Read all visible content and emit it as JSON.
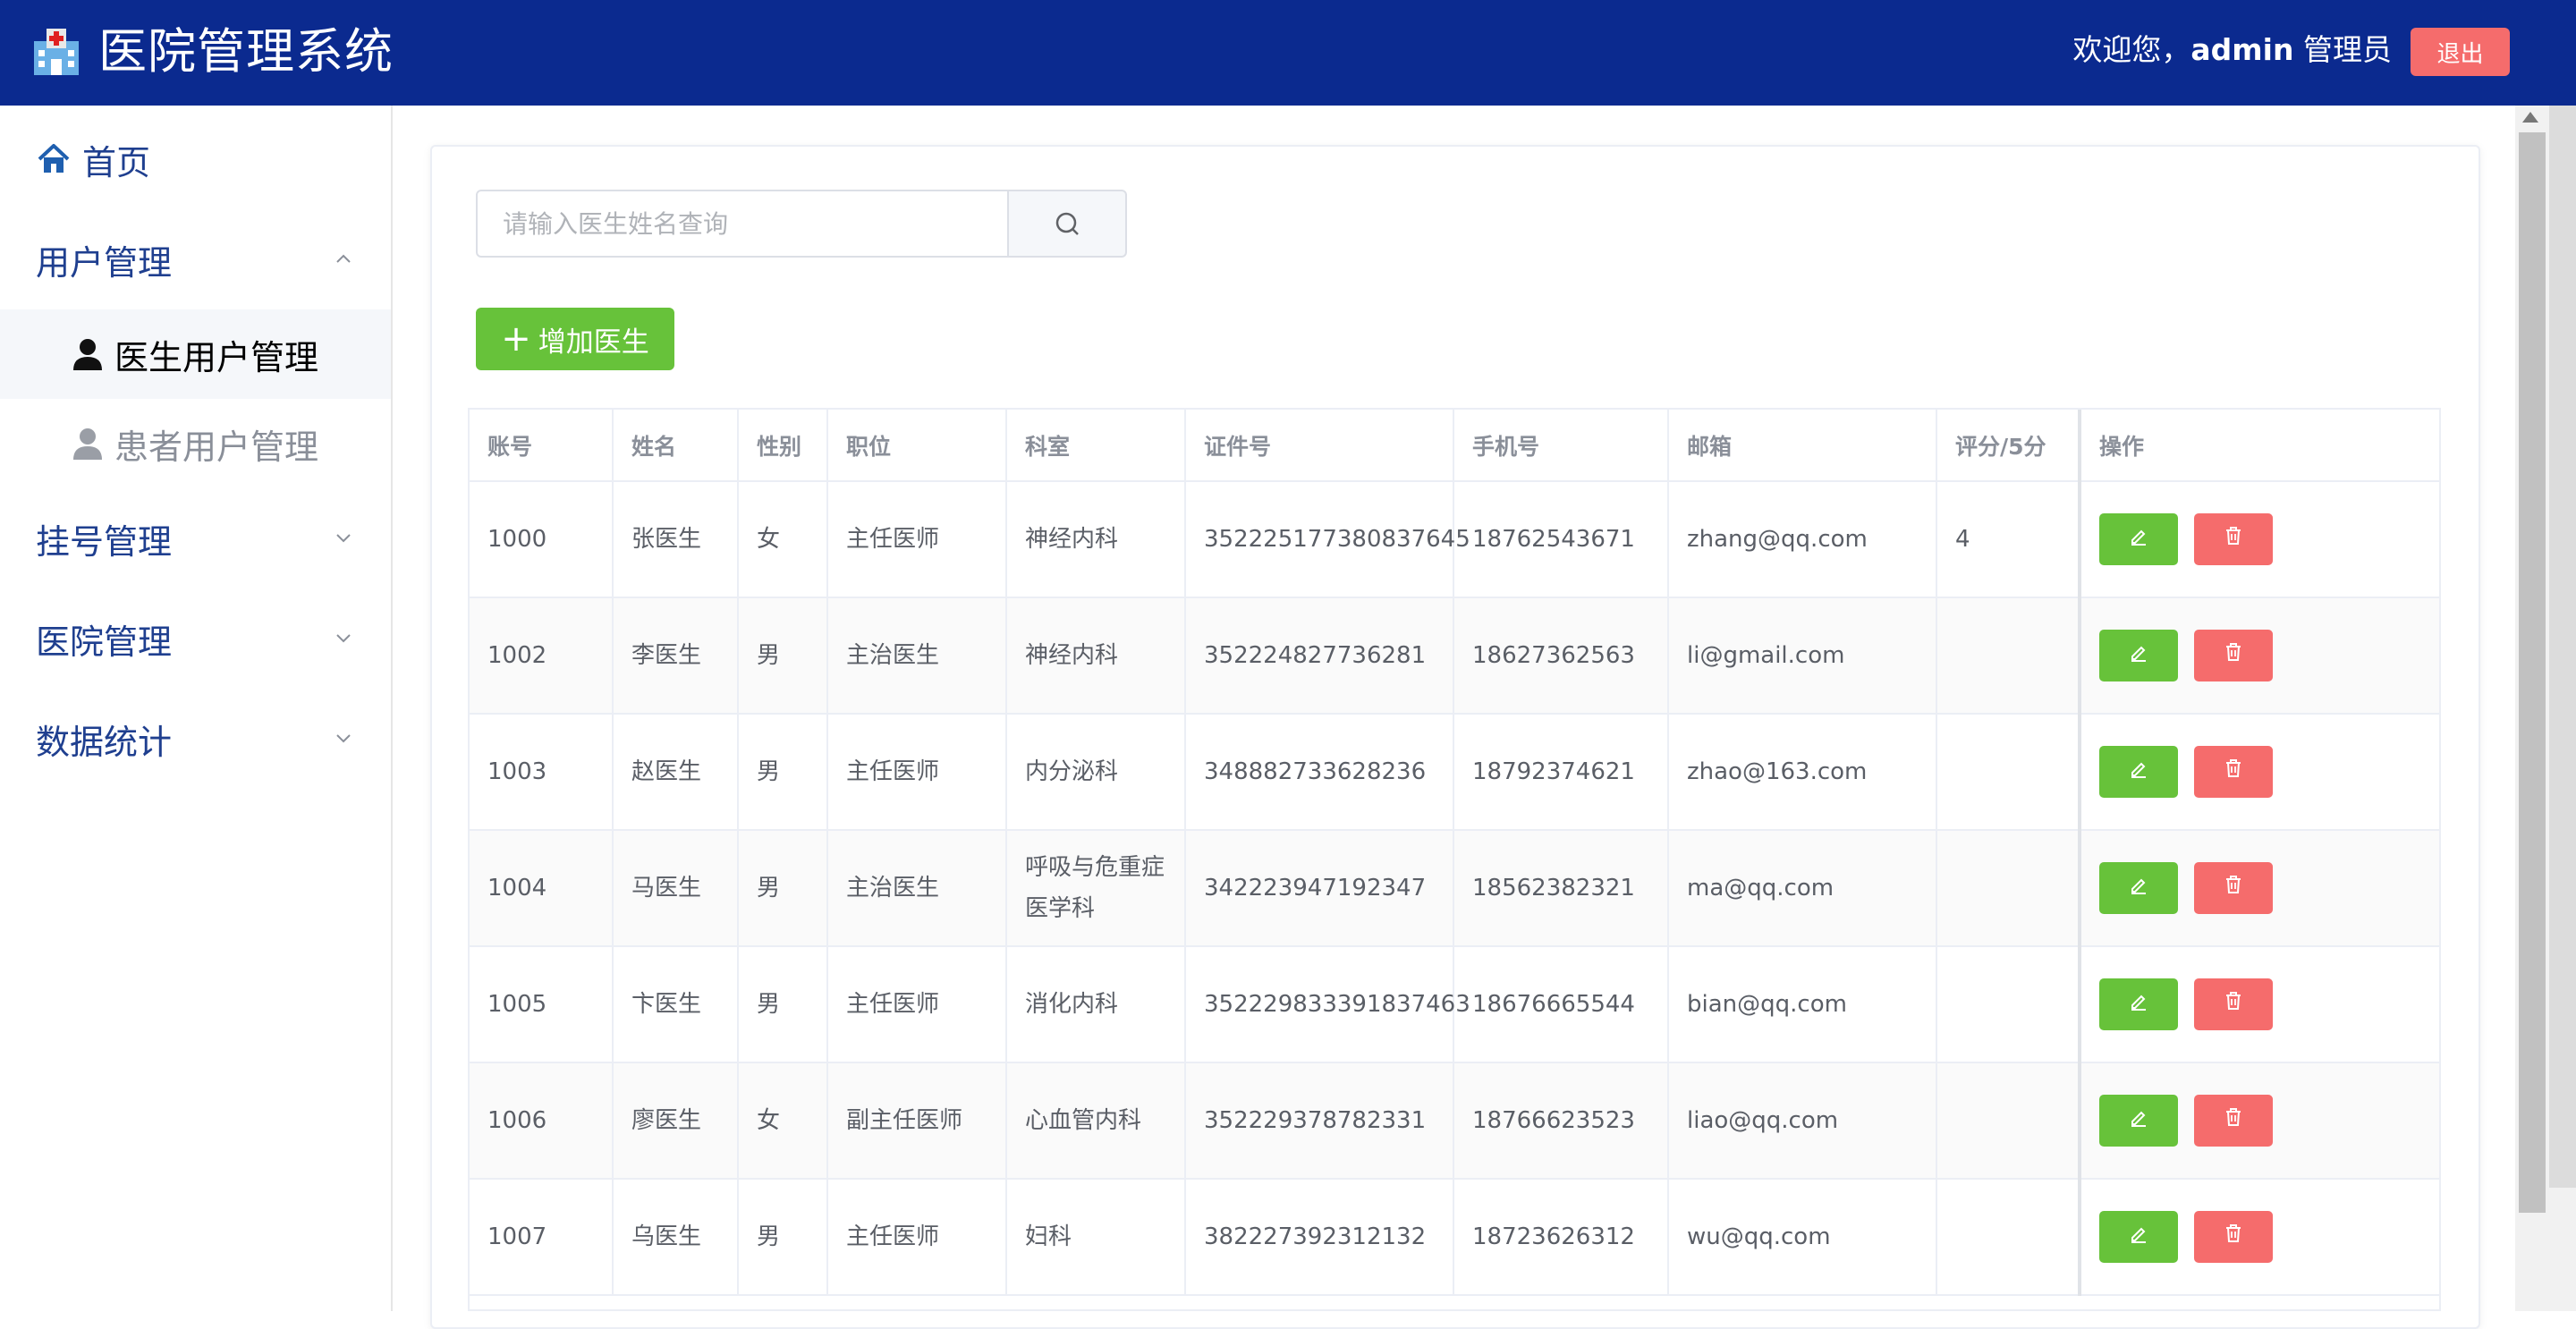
{
  "header": {
    "title": "医院管理系统",
    "welcome_prefix": "欢迎您，",
    "username": "admin",
    "role": "管理员",
    "logout_label": "退出"
  },
  "sidebar": {
    "home": {
      "label": "首页",
      "icon": "home-icon"
    },
    "groups": [
      {
        "label": "用户管理",
        "expanded": true,
        "children": [
          {
            "label": "医生用户管理",
            "active": true,
            "icon": "user-icon"
          },
          {
            "label": "患者用户管理",
            "active": false,
            "icon": "user-icon"
          }
        ]
      },
      {
        "label": "挂号管理",
        "expanded": false
      },
      {
        "label": "医院管理",
        "expanded": false
      },
      {
        "label": "数据统计",
        "expanded": false
      }
    ]
  },
  "search": {
    "placeholder": "请输入医生姓名查询",
    "value": ""
  },
  "add_button_label": "增加医生",
  "table": {
    "columns": [
      "账号",
      "姓名",
      "性别",
      "职位",
      "科室",
      "证件号",
      "手机号",
      "邮箱",
      "评分/5分",
      "操作"
    ],
    "rows": [
      [
        "1000",
        "张医生",
        "女",
        "主任医师",
        "神经内科",
        "352225177380837645",
        "18762543671",
        "zhang@qq.com",
        "4"
      ],
      [
        "1002",
        "李医生",
        "男",
        "主治医生",
        "神经内科",
        "352224827736281",
        "18627362563",
        "li@gmail.com",
        ""
      ],
      [
        "1003",
        "赵医生",
        "男",
        "主任医师",
        "内分泌科",
        "348882733628236",
        "18792374621",
        "zhao@163.com",
        ""
      ],
      [
        "1004",
        "马医生",
        "男",
        "主治医生",
        "呼吸与危重症医学科",
        "342223947192347",
        "18562382321",
        "ma@qq.com",
        ""
      ],
      [
        "1005",
        "卞医生",
        "男",
        "主任医师",
        "消化内科",
        "352229833391837463",
        "18676665544",
        "bian@qq.com",
        ""
      ],
      [
        "1006",
        "廖医生",
        "女",
        "副主任医师",
        "心血管内科",
        "352229378782331",
        "18766623523",
        "liao@qq.com",
        ""
      ],
      [
        "1007",
        "乌医生",
        "男",
        "主任医师",
        "妇科",
        "382227392312132",
        "18723626312",
        "wu@qq.com",
        ""
      ]
    ]
  },
  "colors": {
    "header_bg": "#0b2a8f",
    "accent_green": "#67c23a",
    "danger_red": "#f56c6c",
    "sidebar_text": "#1f3f8f"
  }
}
